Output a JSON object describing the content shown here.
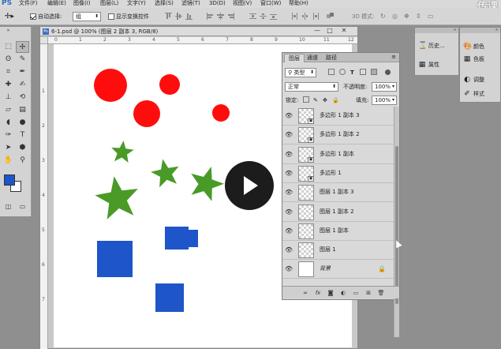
{
  "menubar": {
    "logo": "PS",
    "items": [
      "文件(F)",
      "编辑(E)",
      "图像(I)",
      "图层(L)",
      "文字(Y)",
      "选择(S)",
      "滤镜(T)",
      "3D(D)",
      "视图(V)",
      "窗口(W)",
      "帮助(H)"
    ],
    "brand": "传课"
  },
  "optionsbar": {
    "auto_select_label": "自动选择:",
    "auto_select_checked": true,
    "auto_select_value": "组",
    "show_transform_label": "显示变换控件",
    "show_transform_checked": false,
    "mode_3d_label": "3D 模式:"
  },
  "document": {
    "title": "6-1.psd @ 100% (图层 2 副本 3, RGB/8)",
    "ruler_top_ticks": [
      "0",
      "1",
      "2",
      "3",
      "4",
      "5",
      "6",
      "7",
      "8",
      "9",
      "10",
      "11",
      "12"
    ],
    "ruler_left_ticks": [
      "1",
      "2",
      "3",
      "4",
      "5",
      "6",
      "7"
    ],
    "shape_colors": {
      "red": "#ff0d0d",
      "green": "#4a9a28",
      "blue": "#1e55c8"
    }
  },
  "layers_panel": {
    "tabs": [
      "图层",
      "通道",
      "路径"
    ],
    "active_tab": 0,
    "filter_kind": "类型",
    "blend_mode": "正常",
    "opacity_label": "不透明度:",
    "opacity_value": "100%",
    "lock_label": "锁定:",
    "fill_label": "填充:",
    "fill_value": "100%",
    "layers": [
      {
        "name": "多边形 1 副本 3",
        "smart_object": true,
        "locked": false
      },
      {
        "name": "多边形 1 副本 2",
        "smart_object": true,
        "locked": false
      },
      {
        "name": "多边形 1 副本",
        "smart_object": true,
        "locked": false
      },
      {
        "name": "多边形 1",
        "smart_object": true,
        "locked": false
      },
      {
        "name": "图层 1 副本 3",
        "smart_object": false,
        "locked": false
      },
      {
        "name": "图层 1 副本 2",
        "smart_object": false,
        "locked": false
      },
      {
        "name": "图层 1 副本",
        "smart_object": false,
        "locked": false
      },
      {
        "name": "图层 1",
        "smart_object": false,
        "locked": false
      },
      {
        "name": "背景",
        "smart_object": false,
        "locked": true,
        "italic": true
      }
    ]
  },
  "dock_left": {
    "items": [
      {
        "icon": "history-icon",
        "label": "历史..."
      },
      {
        "icon": "properties-icon",
        "label": "属性"
      }
    ]
  },
  "dock_right": {
    "items": [
      {
        "icon": "color-icon",
        "label": "颜色"
      },
      {
        "icon": "swatches-icon",
        "label": "色板"
      },
      {
        "icon": "adjustments-icon",
        "label": "调整"
      },
      {
        "icon": "styles-icon",
        "label": "样式"
      }
    ]
  }
}
